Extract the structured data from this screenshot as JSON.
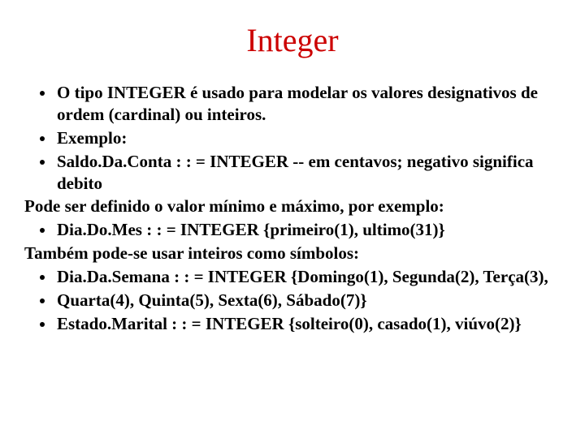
{
  "title": "Integer",
  "bullets": {
    "b1": "O tipo INTEGER é usado para modelar os valores designativos de ordem (cardinal) ou inteiros.",
    "b2": "Exemplo:",
    "b3": "Saldo.Da.Conta : : = INTEGER -- em centavos; negativo significa debito",
    "p1": "Pode ser definido o valor mínimo e máximo, por exemplo:",
    "b4": "Dia.Do.Mes : : = INTEGER {primeiro(1), ultimo(31)}",
    "p2": "Também pode-se usar inteiros como símbolos:",
    "b5": "Dia.Da.Semana : : = INTEGER {Domingo(1), Segunda(2), Terça(3),",
    "b6": "Quarta(4), Quinta(5), Sexta(6), Sábado(7)}",
    "b7": "Estado.Marital : : = INTEGER {solteiro(0), casado(1), viúvo(2)}"
  }
}
